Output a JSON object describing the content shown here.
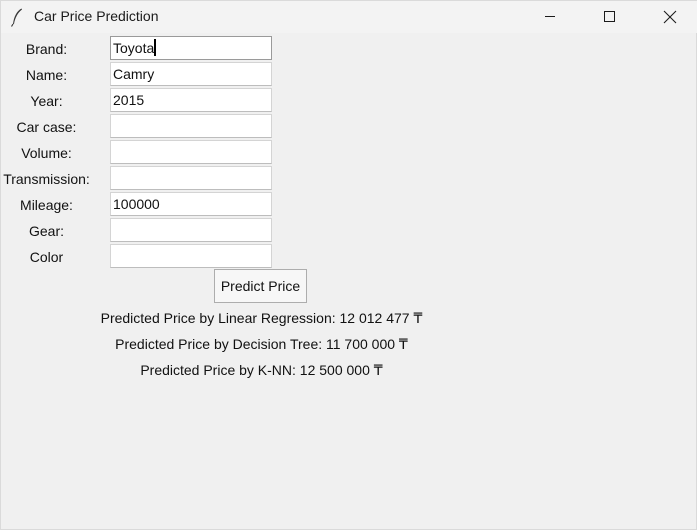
{
  "window": {
    "title": "Car Price Prediction",
    "icons": {
      "app": "feather-icon",
      "minimize": "minimize-icon",
      "maximize": "maximize-icon",
      "close": "close-icon"
    }
  },
  "form": {
    "fields": [
      {
        "label": "Brand:",
        "value": "Toyota"
      },
      {
        "label": "Name:",
        "value": "Camry"
      },
      {
        "label": "Year:",
        "value": "2015"
      },
      {
        "label": "Car case:",
        "value": ""
      },
      {
        "label": "Volume:",
        "value": ""
      },
      {
        "label": "Transmission:",
        "value": ""
      },
      {
        "label": "Mileage:",
        "value": "100000"
      },
      {
        "label": "Gear:",
        "value": ""
      },
      {
        "label": "Color",
        "value": ""
      }
    ],
    "predict_button": "Predict Price"
  },
  "results": {
    "linear_regression": "Predicted Price by Linear Regression: 12 012 477 ₸",
    "decision_tree": "Predicted Price by Decision Tree: 11 700 000 ₸",
    "knn": "Predicted Price by K-NN: 12 500 000 ₸"
  }
}
